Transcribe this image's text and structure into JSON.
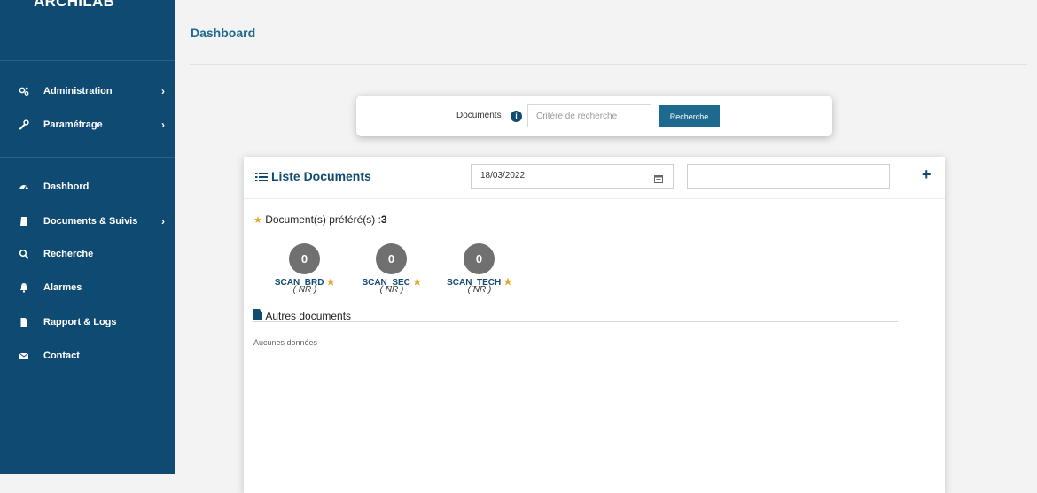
{
  "app": {
    "brand": "ARCHILAB"
  },
  "sidebar": {
    "items": [
      {
        "label": "Administration",
        "icon": "cogs-icon",
        "has_chevron": true
      },
      {
        "label": "Paramétrage",
        "icon": "wrench-icon",
        "has_chevron": true
      },
      {
        "label": "Dashbord",
        "icon": "dashboard-icon",
        "has_chevron": false
      },
      {
        "label": "Documents & Suivis",
        "icon": "book-icon",
        "has_chevron": true
      },
      {
        "label": "Recherche",
        "icon": "search-icon",
        "has_chevron": false
      },
      {
        "label": "Alarmes",
        "icon": "bell-icon",
        "has_chevron": false
      },
      {
        "label": "Rapport & Logs",
        "icon": "file-icon",
        "has_chevron": false
      },
      {
        "label": "Contact",
        "icon": "envelope-icon",
        "has_chevron": false
      }
    ],
    "chevron": "›"
  },
  "header": {
    "title": "Dashboard"
  },
  "search": {
    "label": "Documents",
    "info_icon": "i",
    "placeholder": "Critère de recherche",
    "value": "",
    "button_label": "Recherche"
  },
  "list": {
    "title": "Liste Documents",
    "date_value": "18/03/2022",
    "filter_value": "",
    "add_label": "+"
  },
  "favorites": {
    "title_prefix": "Document(s) préféré(s) : ",
    "count": "3",
    "items": [
      {
        "count": "0",
        "name": "SCAN_BRD",
        "status": "( NR )"
      },
      {
        "count": "0",
        "name": "SCAN_SEC",
        "status": "( NR )"
      },
      {
        "count": "0",
        "name": "SCAN_TECH",
        "status": "( NR )"
      }
    ]
  },
  "others": {
    "title": "Autres documents",
    "empty_text": "Aucunes données"
  },
  "colors": {
    "sidebar_bg": "#0f4a73",
    "accent": "#1e6a8e",
    "star": "#e2a92a",
    "badge": "#707070"
  }
}
